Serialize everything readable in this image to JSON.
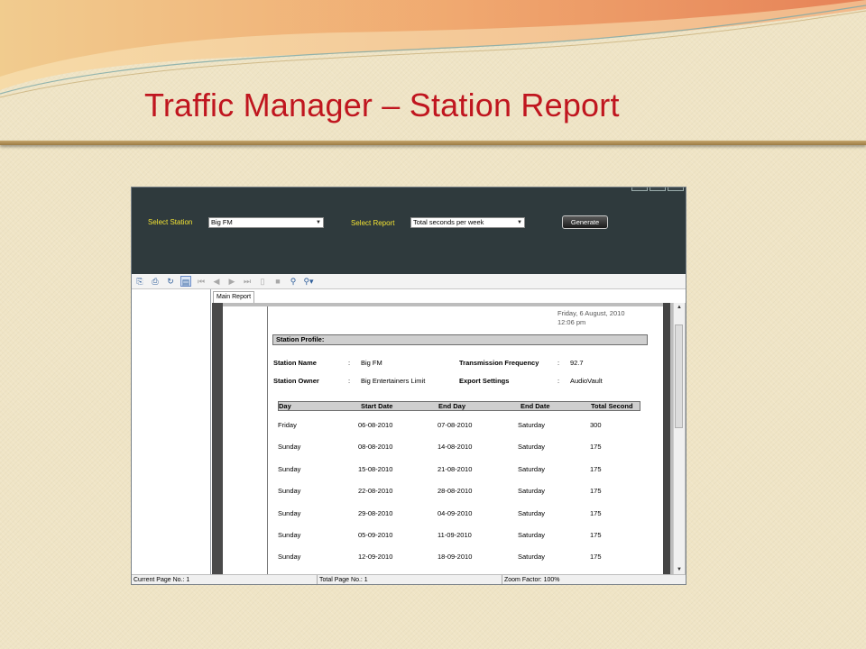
{
  "slide": {
    "title": "Traffic Manager – Station Report"
  },
  "filters": {
    "station_label": "Select Station",
    "station_value": "Big FM",
    "report_label": "Select Report",
    "report_value": "Total seconds per week",
    "generate_label": "Generate"
  },
  "toolbar": {
    "icons": [
      "export-icon",
      "print-icon",
      "refresh-icon",
      "tree-toggle-icon",
      "first-page-icon",
      "prev-page-icon",
      "next-page-icon",
      "last-page-icon",
      "go-to-page-icon",
      "stop-icon",
      "find-icon",
      "zoom-icon"
    ]
  },
  "tab": {
    "label": "Main Report"
  },
  "report": {
    "printed_date": "Friday, 6 August, 2010",
    "printed_time": "12:06 pm",
    "profile_title": "Station Profile:",
    "station_name_label": "Station Name",
    "station_name_value": "Big FM",
    "owner_label": "Station Owner",
    "owner_value": "Big Entertainers Limit",
    "freq_label": "Transmission Frequency",
    "freq_value": "92.7",
    "export_label": "Export Settings",
    "export_value": "AudioVault",
    "colon": ":",
    "columns": [
      "Day",
      "Start Date",
      "End Day",
      "End Date",
      "Total Second"
    ],
    "rows": [
      [
        "Friday",
        "06-08-2010",
        "07-08-2010",
        "Saturday",
        "300"
      ],
      [
        "Sunday",
        "08-08-2010",
        "14-08-2010",
        "Saturday",
        "175"
      ],
      [
        "Sunday",
        "15-08-2010",
        "21-08-2010",
        "Saturday",
        "175"
      ],
      [
        "Sunday",
        "22-08-2010",
        "28-08-2010",
        "Saturday",
        "175"
      ],
      [
        "Sunday",
        "29-08-2010",
        "04-09-2010",
        "Saturday",
        "175"
      ],
      [
        "Sunday",
        "05-09-2010",
        "11-09-2010",
        "Saturday",
        "175"
      ],
      [
        "Sunday",
        "12-09-2010",
        "18-09-2010",
        "Saturday",
        "175"
      ]
    ]
  },
  "status": {
    "current_page": "Current Page No.: 1",
    "total_page": "Total Page No.: 1",
    "zoom": "Zoom Factor: 100%"
  },
  "colors": {
    "title": "#c0161f",
    "app_header": "#2f3a3d",
    "label_yellow": "#f2e233"
  }
}
